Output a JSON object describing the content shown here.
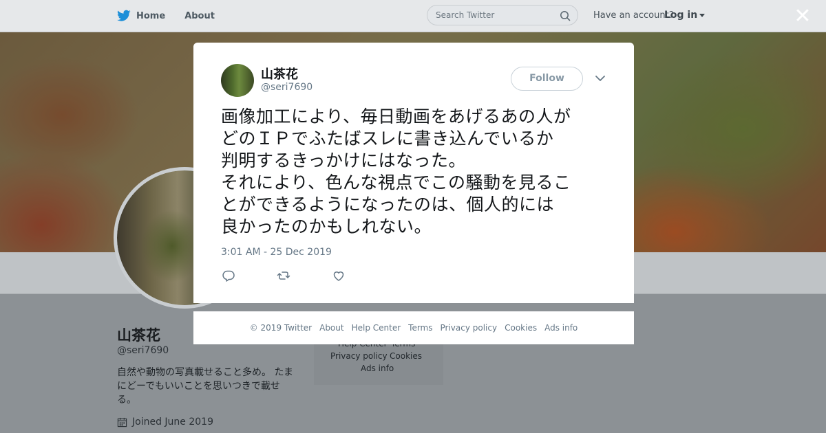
{
  "topbar": {
    "home_label": "Home",
    "about_label": "About",
    "search_placeholder": "Search Twitter",
    "have_account": "Have an account?",
    "login_label": "Log in",
    "close_glyph": "✕"
  },
  "profile": {
    "name": "山茶花",
    "handle": "@seri7690",
    "bio": "自然や動物の写真載せること多め。 たまにどーでもいいことを思いつきで載せる。",
    "joined": "Joined June 2019",
    "footer_links": [
      "Help Center",
      "Terms",
      "Privacy policy",
      "Cookies",
      "Ads info"
    ]
  },
  "tweet": {
    "author_name": "山茶花",
    "author_handle": "@seri7690",
    "follow_label": "Follow",
    "text": "画像加工により、毎日動画をあげるあの人が\nどのＩＰでふたばスレに書き込んでいるか\n判明するきっかけにはなった。\nそれにより、色んな視点でこの騒動を見るこ\nとができるようになったのは、個人的には\n良かったのかもしれない。",
    "timestamp": "3:01 AM - 25 Dec 2019"
  },
  "footer": {
    "copyright": "© 2019 Twitter",
    "links": [
      "About",
      "Help Center",
      "Terms",
      "Privacy policy",
      "Cookies",
      "Ads info"
    ]
  },
  "icons": {
    "brand": "twitter-bird-icon",
    "search": "search-icon",
    "close": "close-icon",
    "reply": "reply-icon",
    "retweet": "retweet-icon",
    "like": "heart-icon",
    "more": "chevron-down-icon",
    "calendar": "calendar-icon"
  },
  "colors": {
    "brand_blue": "#1da1f2",
    "muted_text": "#657786",
    "overlay": "#8a8f93"
  }
}
